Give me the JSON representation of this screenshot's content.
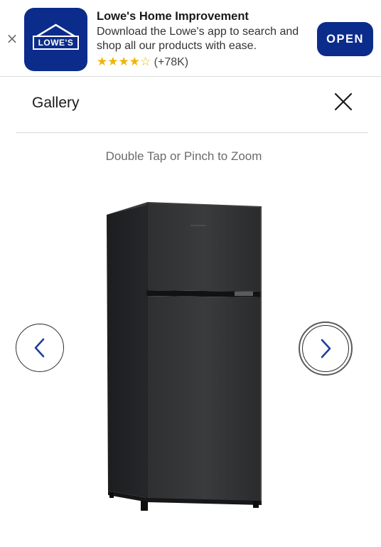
{
  "banner": {
    "app_name": "Lowe's Home Improvement",
    "description": "Download the Lowe's app to search and shop all our products with ease.",
    "rating_count": "(+78K)",
    "stars": "★★★★☆",
    "open_label": "OPEN",
    "close_glyph": "×",
    "logo_text": "LOWE'S"
  },
  "gallery": {
    "title": "Gallery",
    "zoom_hint": "Double Tap or Pinch to Zoom"
  },
  "colors": {
    "brand_blue": "#0c2c8c",
    "star_gold": "#f0b400"
  },
  "icons": {
    "banner_close": "close-icon",
    "gallery_close": "close-icon",
    "prev": "chevron-left-icon",
    "next": "chevron-right-icon"
  }
}
